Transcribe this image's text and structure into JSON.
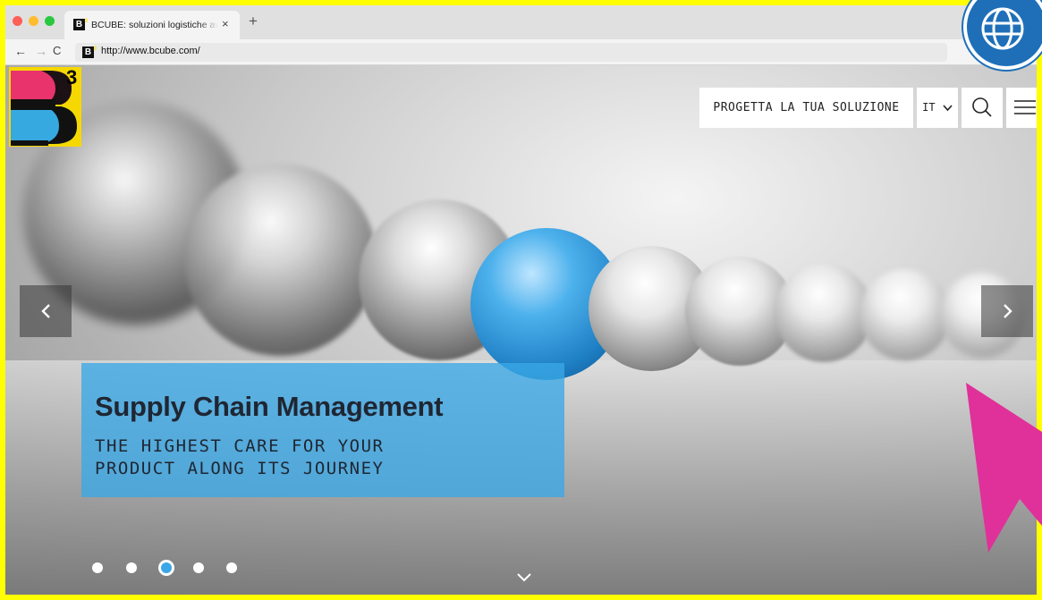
{
  "browser": {
    "tab_title": "BCUBE: soluzioni logistiche avanzate",
    "tab_close": "×",
    "new_tab": "+",
    "url": "http://www.bcube.com/",
    "nav": {
      "back": "←",
      "forward": "→",
      "reload": "C"
    },
    "favicon_letter": "B",
    "favicon_sup": "3"
  },
  "site": {
    "logo_letter": "B",
    "logo_sup": "3",
    "cta_label": "PROGETTA LA TUA SOLUZIONE",
    "language": "IT",
    "icons": [
      "search-icon",
      "hamburger-menu-icon",
      "chevron-left-icon",
      "chevron-right-icon",
      "chevron-down-icon"
    ]
  },
  "slider": {
    "prev": "‹",
    "next": "›",
    "caption_title": "Supply Chain Management",
    "caption_subtitle": "THE HIGHEST CARE FOR YOUR\nPRODUCT ALONG ITS JOURNEY",
    "slide_count": 5,
    "active_slide": 3
  },
  "colors": {
    "frame": "#ffff00",
    "accent_blue": "#3aa6e8",
    "logo_yellow": "#f5d800",
    "logo_pink": "#e8336d",
    "logo_blue": "#36a9e1",
    "pointer_magenta": "#e0309a"
  }
}
